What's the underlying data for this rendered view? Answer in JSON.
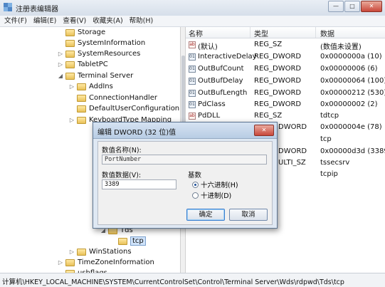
{
  "window": {
    "title": "注册表编辑器",
    "buttons": [
      "—",
      "□",
      "✕"
    ]
  },
  "menu": [
    "文件(F)",
    "编辑(E)",
    "查看(V)",
    "收藏夹(A)",
    "帮助(H)"
  ],
  "tree": {
    "items": [
      {
        "label": "Storage",
        "expander": ""
      },
      {
        "label": "SystemInformation",
        "expander": ""
      },
      {
        "label": "SystemResources",
        "expander": "▷"
      },
      {
        "label": "TabletPC",
        "expander": "▷"
      },
      {
        "label": "Terminal Server",
        "expander": "◢"
      },
      {
        "label": "AddIns",
        "expander": "▷"
      },
      {
        "label": "ConnectionHandler",
        "expander": ""
      },
      {
        "label": "DefaultUserConfiguration",
        "expander": ""
      },
      {
        "label": "KeyboardType Mapping",
        "expander": "▷"
      },
      {
        "label": "Tds",
        "expander": "◢"
      },
      {
        "label": "tcp",
        "expander": ""
      },
      {
        "label": "WinStations",
        "expander": "▷"
      },
      {
        "label": "TimeZoneInformation",
        "expander": "▷"
      },
      {
        "label": "usbflags",
        "expander": ""
      }
    ]
  },
  "values": {
    "headers": {
      "name": "名称",
      "type": "类型",
      "data": "数据"
    },
    "rows": [
      {
        "name": "(默认)",
        "type": "REG_SZ",
        "data": "(数值未设置)",
        "icon": "ab"
      },
      {
        "name": "InteractiveDelay",
        "type": "REG_DWORD",
        "data": "0x0000000a (10)",
        "icon": "01"
      },
      {
        "name": "OutBufCount",
        "type": "REG_DWORD",
        "data": "0x00000006 (6)",
        "icon": "01"
      },
      {
        "name": "OutBufDelay",
        "type": "REG_DWORD",
        "data": "0x00000064 (100)",
        "icon": "01"
      },
      {
        "name": "OutBufLength",
        "type": "REG_DWORD",
        "data": "0x00000212 (530)",
        "icon": "01"
      },
      {
        "name": "PdClass",
        "type": "REG_DWORD",
        "data": "0x00000002 (2)",
        "icon": "01"
      },
      {
        "name": "PdDLL",
        "type": "REG_SZ",
        "data": "tdtcp",
        "icon": "ab"
      },
      {
        "name": "",
        "type": "DWORD",
        "data": "0x0000004e (78)",
        "icon": ""
      },
      {
        "name": "",
        "type": "",
        "data": "tcp",
        "icon": ""
      },
      {
        "name": "",
        "type": "DWORD",
        "data": "0x00000d3d (3389)",
        "icon": ""
      },
      {
        "name": "",
        "type": "ULTI_SZ",
        "data": "tssecsrv",
        "icon": ""
      },
      {
        "name": "",
        "type": "",
        "data": "tcpip",
        "icon": ""
      }
    ]
  },
  "dialog": {
    "title": "编辑 DWORD (32 位)值",
    "close": "✕",
    "name_label": "数值名称(N):",
    "name_value": "PortNumber",
    "data_label": "数值数据(V):",
    "data_value": "3389",
    "base_label": "基数",
    "radio_hex": "十六进制(H)",
    "radio_dec": "十进制(D)",
    "ok": "确定",
    "cancel": "取消"
  },
  "status": {
    "path": "计算机\\HKEY_LOCAL_MACHINE\\SYSTEM\\CurrentControlSet\\Control\\Terminal Server\\Wds\\rdpwd\\Tds\\tcp"
  }
}
